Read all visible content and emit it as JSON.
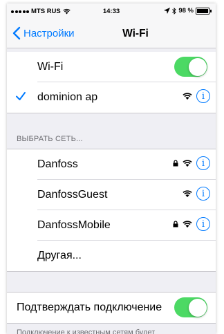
{
  "status_bar": {
    "carrier": "MTS RUS",
    "time": "14:33",
    "battery_text": "98 %",
    "battery_level": 0.98
  },
  "nav": {
    "back_label": "Настройки",
    "title": "Wi-Fi"
  },
  "wifi_toggle": {
    "label": "Wi-Fi",
    "on": true
  },
  "connected_network": {
    "name": "dominion ap",
    "icons": [
      "check-icon",
      "wifi-icon",
      "info-icon"
    ]
  },
  "choose_network": {
    "header": "ВЫБРАТЬ СЕТЬ...",
    "networks": [
      {
        "name": "Danfoss",
        "locked": true
      },
      {
        "name": "DanfossGuest",
        "locked": false
      },
      {
        "name": "DanfossMobile",
        "locked": true
      }
    ],
    "other_label": "Другая..."
  },
  "ask_to_join": {
    "label": "Подтверждать подключение",
    "on": true,
    "footer": "Подключение к известным сетям будет"
  },
  "colors": {
    "accent": "#007aff",
    "toggle_on": "#4cd964",
    "background": "#efeff4"
  }
}
